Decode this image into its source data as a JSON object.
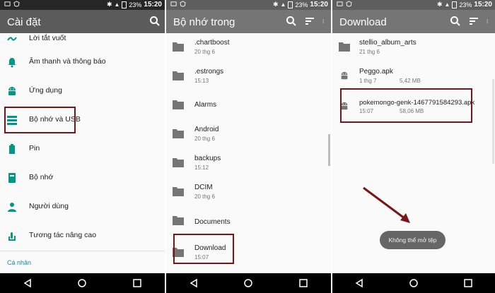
{
  "status": {
    "battery": "23%",
    "time": "15:20"
  },
  "settings_panel": {
    "title": "Cài đặt",
    "items": [
      {
        "label": "Lời tắt vuốt",
        "icon": "gesture-icon"
      },
      {
        "label": "Âm thanh và thông báo",
        "icon": "bell-icon"
      },
      {
        "label": "Ứng dụng",
        "icon": "android-icon"
      },
      {
        "label": "Bộ nhớ và USB",
        "icon": "storage-icon"
      },
      {
        "label": "Pin",
        "icon": "battery-icon"
      },
      {
        "label": "Bộ nhớ",
        "icon": "memory-icon"
      },
      {
        "label": "Người dùng",
        "icon": "user-icon"
      },
      {
        "label": "Tương tác nâng cao",
        "icon": "touch-icon"
      }
    ],
    "section": "Cá nhân"
  },
  "storage_panel": {
    "title": "Bộ nhớ trong",
    "rows": [
      {
        "name": ".chartboost",
        "date": "20 thg 6"
      },
      {
        "name": ".estrongs",
        "date": "15:13"
      },
      {
        "name": "Alarms",
        "date": ""
      },
      {
        "name": "Android",
        "date": "20 thg 6"
      },
      {
        "name": "backups",
        "date": "15:12"
      },
      {
        "name": "DCIM",
        "date": "20 thg 6"
      },
      {
        "name": "Documents",
        "date": ""
      },
      {
        "name": "Download",
        "date": "15:07"
      }
    ]
  },
  "download_panel": {
    "title": "Download",
    "rows": [
      {
        "name": "stellio_album_arts",
        "date": "21 thg 6",
        "size": "",
        "type": "folder"
      },
      {
        "name": "Peggo.apk",
        "date": "1 thg 7",
        "size": "5,42 MB",
        "type": "apk"
      },
      {
        "name": "pokemongo-genk-1467791584293.apk",
        "date": "15:07",
        "size": "58,06 MB",
        "type": "apk"
      }
    ],
    "toast": "Không thể mở tệp"
  },
  "colors": {
    "toolbar_settings": "#5b5b5b",
    "toolbar_files": "#757575",
    "status_settings": "#262626",
    "status_files": "#5e5e5e",
    "accent": "#7a1418"
  }
}
